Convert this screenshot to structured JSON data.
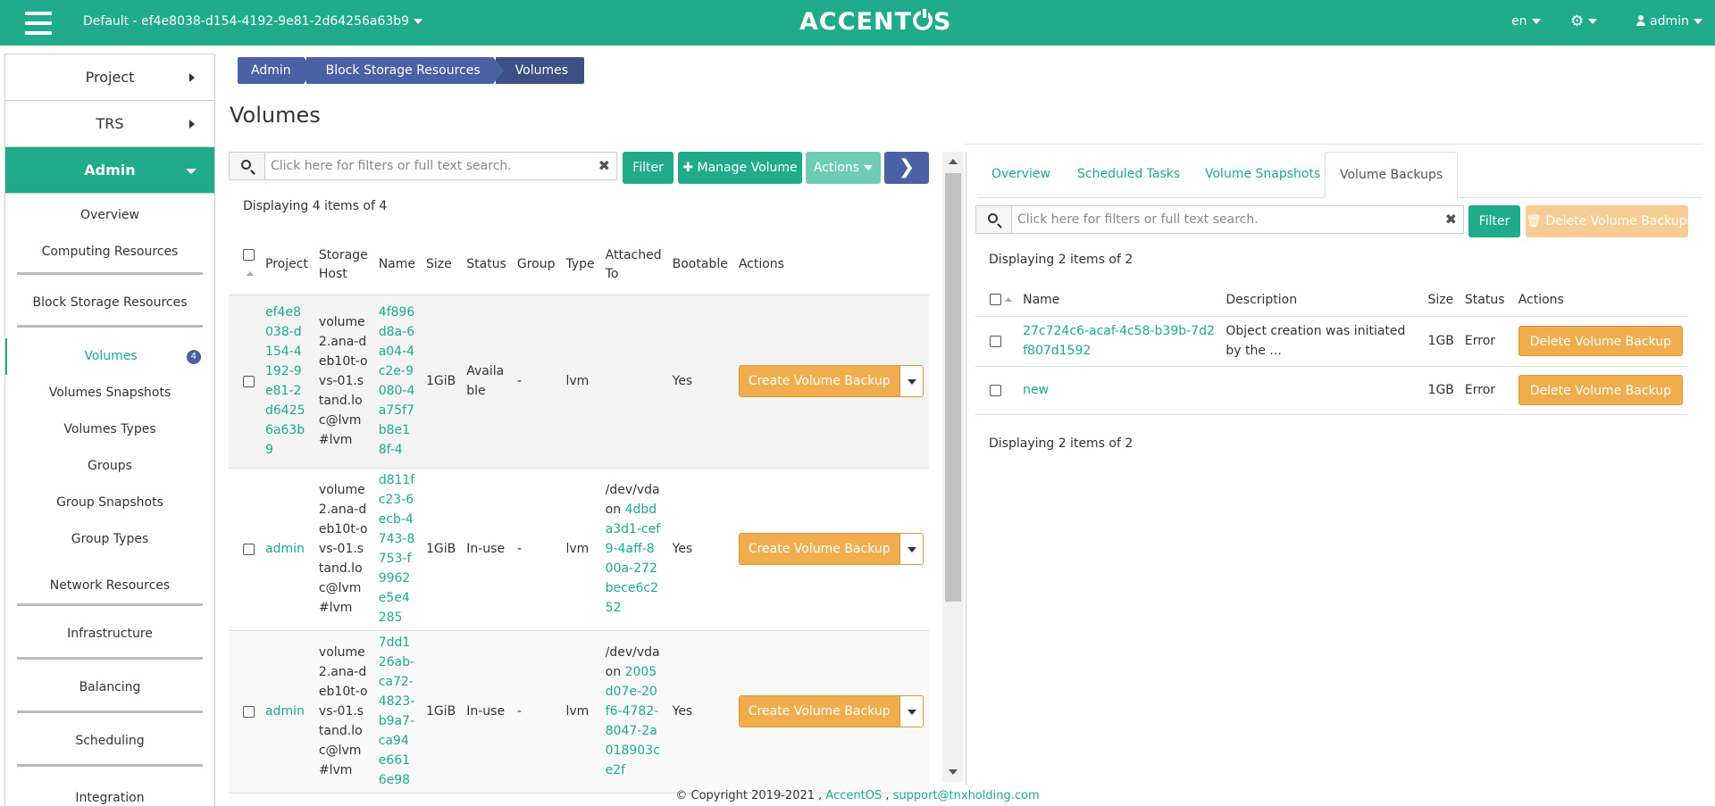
{
  "topbar": {
    "project_label": "Default - ef4e8038-d154-4192-9e81-2d64256a63b9",
    "brand_prefix": "ACCENT",
    "brand_suffix": "S",
    "lang": "en",
    "user": "admin",
    "bg_color": "#1fab8c"
  },
  "sidebar": {
    "sections": [
      {
        "label": "Project"
      },
      {
        "label": "TRS"
      },
      {
        "label": "Admin"
      }
    ],
    "items": [
      {
        "label": "Overview"
      },
      {
        "label": "Computing Resources"
      },
      {
        "label": "Block Storage Resources"
      },
      {
        "label": "Volumes",
        "badge": "4"
      },
      {
        "label": "Volumes Snapshots"
      },
      {
        "label": "Volumes Types"
      },
      {
        "label": "Groups"
      },
      {
        "label": "Group Snapshots"
      },
      {
        "label": "Group Types"
      },
      {
        "label": "Network Resources"
      },
      {
        "label": "Infrastructure"
      },
      {
        "label": "Balancing"
      },
      {
        "label": "Scheduling"
      },
      {
        "label": "Integration"
      }
    ]
  },
  "breadcrumb": [
    "Admin",
    "Block Storage Resources",
    "Volumes"
  ],
  "page_title": "Volumes",
  "volumes": {
    "search_placeholder": "Click here for filters or full text search.",
    "filter_label": "Filter",
    "manage_label": "Manage Volume",
    "actions_label": "Actions",
    "count_text": "Displaying 4 items of 4",
    "columns": [
      "Project",
      "Storage Host",
      "Name",
      "Size",
      "Status",
      "Group",
      "Type",
      "Attached To",
      "Bootable",
      "Actions"
    ],
    "rows": [
      {
        "project": "ef4e8038-d154-4192-9e81-2d64256a63b9",
        "host": "volume2.ana-deb10t-ovs-01.stand.loc@lvm#lvm",
        "name": "4f896d8a-6a04-4c2e-9080-4a75f7b8e18f-4",
        "size": "1GiB",
        "status": "Available",
        "group": "-",
        "type": "lvm",
        "attached_prefix": "",
        "attached_link": "",
        "bootable": "Yes",
        "action": "Create Volume Backup"
      },
      {
        "project": "admin",
        "host": "volume2.ana-deb10t-ovs-01.stand.loc@lvm#lvm",
        "name": "d811fc23-6ecb-4743-8753-f9962e5e4285",
        "size": "1GiB",
        "status": "In-use",
        "group": "-",
        "type": "lvm",
        "attached_prefix": "/dev/vda on",
        "attached_link": "4dbda3d1-cef9-4aff-800a-272bece6c252",
        "bootable": "Yes",
        "action": "Create Volume Backup"
      },
      {
        "project": "admin",
        "host": "volume2.ana-deb10t-ovs-01.stand.loc@lvm#lvm",
        "name": "7dd126ab-ca72-4823-b9a7-ca94e6616e98",
        "size": "1GiB",
        "status": "In-use",
        "group": "-",
        "type": "lvm",
        "attached_prefix": "/dev/vda on",
        "attached_link": "2005d07e-20f6-4782-8047-2a018903ce2f",
        "bootable": "Yes",
        "action": "Create Volume Backup"
      }
    ]
  },
  "detail": {
    "tabs": [
      "Overview",
      "Scheduled Tasks",
      "Volume Snapshots",
      "Volume Backups"
    ],
    "search_placeholder": "Click here for filters or full text search.",
    "filter_label": "Filter",
    "delete_all_label": "Delete Volume Backups",
    "count_text": "Displaying 2 items of 2",
    "columns": [
      "Name",
      "Description",
      "Size",
      "Status",
      "Actions"
    ],
    "rows": [
      {
        "name": "27c724c6-acaf-4c58-b39b-7d2f807d1592",
        "description": "Object creation was initiated by the ...",
        "size": "1GB",
        "status": "Error",
        "action": "Delete Volume Backup"
      },
      {
        "name": "new",
        "description": "",
        "size": "1GB",
        "status": "Error",
        "action": "Delete Volume Backup"
      }
    ],
    "count_text_bottom": "Displaying 2 items of 2"
  },
  "footer": {
    "copyright": "© Copyright 2019-2021 ,",
    "brand_link": "AccentOS",
    "separator": ",",
    "email": "support@tnxholding.com"
  }
}
